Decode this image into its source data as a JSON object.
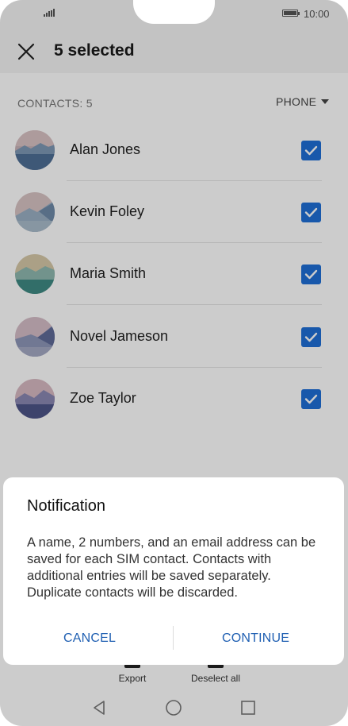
{
  "status_bar": {
    "time": "10:00"
  },
  "app_bar": {
    "title": "5 selected"
  },
  "list_header": {
    "count_label": "CONTACTS: 5",
    "filter_label": "PHONE"
  },
  "contacts": [
    {
      "name": "Alan Jones",
      "checked": true
    },
    {
      "name": "Kevin Foley",
      "checked": true
    },
    {
      "name": "Maria Smith",
      "checked": true
    },
    {
      "name": "Novel Jameson",
      "checked": true
    },
    {
      "name": "Zoe Taylor",
      "checked": true
    }
  ],
  "bottom_bar": {
    "export_label": "Export",
    "deselect_label": "Deselect all"
  },
  "dialog": {
    "title": "Notification",
    "body": "A name, 2 numbers, and an email address can be saved for each SIM contact. Contacts with additional entries will be saved separately. Duplicate contacts will be discarded.",
    "cancel_label": "CANCEL",
    "continue_label": "CONTINUE"
  },
  "colors": {
    "accent": "#1f6fd6",
    "dialog_button": "#1f5fb2",
    "scrim": "rgba(0,0,0,0.2)"
  },
  "icons": [
    "signal-icon",
    "battery-icon",
    "close-icon",
    "dropdown-arrow-icon",
    "checkbox-checked-icon",
    "export-icon",
    "deselect-icon",
    "back-icon",
    "home-icon",
    "recents-icon"
  ]
}
